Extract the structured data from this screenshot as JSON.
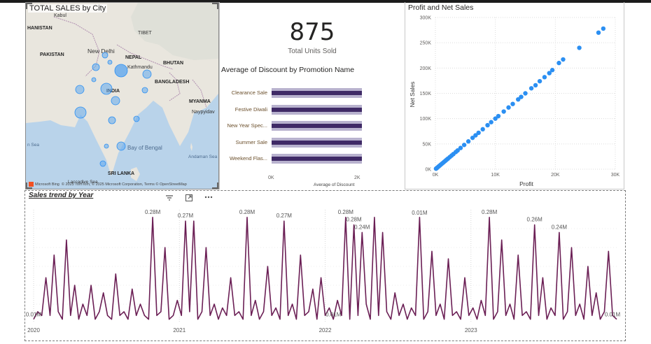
{
  "map": {
    "title": "TOTAL SALES by City",
    "labels": {
      "kabul": "Kabul",
      "afghanistan": "HANISTAN",
      "pakistan": "PAKISTAN",
      "tibet": "TIBET",
      "new_delhi": "New Delhi",
      "nepal": "NEPAL",
      "kathmandu": "Kathmandu",
      "bhutan": "BHUTAN",
      "india": "INDIA",
      "bangladesh": "BANGLADESH",
      "myanmar": "MYANMA",
      "naypyidaw": "Naypyidav",
      "bay_of_bengal": "Bay of Bengal",
      "arabian_sea": "n Sea",
      "andaman_sea": "Andaman Sea",
      "sri_lanka": "SRI LANKA",
      "laccadive": "Laccadive Sea"
    },
    "attribution": "© 2025 TomTom, © 2025 Microsoft Corporation, Terms © OpenStreetMap",
    "bing_label": "Microsoft Bing"
  },
  "kpi": {
    "value": "875",
    "label": "Total Units Sold"
  },
  "discount": {
    "title": "Average of Discount by Promotion Name",
    "xlabel": "Average of Discount",
    "ticks": [
      "0K",
      "2K"
    ],
    "categories": [
      "Clearance Sale",
      "Festive Diwali",
      "New Year Spec...",
      "Summer Sale",
      "Weekend Flas..."
    ]
  },
  "scatter": {
    "title": "Profit and Net Sales",
    "xlabel": "Profit",
    "ylabel": "Net Sales",
    "xticks": [
      "0K",
      "10K",
      "20K",
      "30K"
    ],
    "yticks": [
      "0K",
      "50K",
      "100K",
      "150K",
      "200K",
      "250K",
      "300K"
    ],
    "color": "#2b8ff2"
  },
  "line": {
    "title": "Sales trend by Year",
    "years": [
      "2020",
      "2021",
      "2022",
      "2023"
    ],
    "color": "#6b1f55",
    "icons": [
      "filter-icon",
      "focus-mode-icon",
      "more-options-icon"
    ]
  },
  "chart_data": [
    {
      "type": "bar",
      "title": "Average of Discount by Promotion Name",
      "categories": [
        "Clearance Sale",
        "Festive Diwali",
        "New Year Spec...",
        "Summer Sale",
        "Weekend Flas..."
      ],
      "values": [
        2100,
        2100,
        2100,
        2100,
        2100
      ],
      "xlabel": "Average of Discount",
      "xlim": [
        0,
        2000
      ],
      "orientation": "horizontal"
    },
    {
      "type": "scatter",
      "title": "Profit and Net Sales",
      "xlabel": "Profit",
      "ylabel": "Net Sales",
      "xlim": [
        0,
        30000
      ],
      "ylim": [
        0,
        300000
      ],
      "x": [
        28000,
        27200,
        24000,
        21300,
        20600,
        19500,
        19000,
        18200,
        17400,
        16700,
        16000,
        15000,
        14300,
        13800,
        12900,
        12200,
        11400,
        10500,
        10000,
        9300,
        8700,
        7900,
        7200,
        6700,
        6200,
        5500,
        4800,
        4200,
        3700,
        3400,
        3000,
        2700,
        2400,
        2100,
        1900,
        1700,
        1500,
        1300,
        1100,
        900,
        700,
        500,
        300,
        200,
        100
      ],
      "y": [
        278000,
        270000,
        240000,
        217000,
        210000,
        196000,
        190000,
        182000,
        174000,
        166000,
        160000,
        150000,
        143000,
        138000,
        129000,
        122000,
        114000,
        105000,
        100000,
        93000,
        87000,
        79000,
        72000,
        67000,
        62000,
        55000,
        48000,
        42000,
        37000,
        34000,
        30000,
        27000,
        24000,
        21000,
        19000,
        17000,
        15000,
        13000,
        11000,
        9000,
        7000,
        5000,
        3000,
        2000,
        1000
      ],
      "grid": true
    },
    {
      "type": "line",
      "title": "Sales trend by Year",
      "xlabel": "",
      "ylabel": "",
      "categories": [
        "2020",
        "2021",
        "2022",
        "2023"
      ],
      "ylim": [
        0,
        0.3
      ],
      "unit": "M",
      "values": [
        0.01,
        0.03,
        0.02,
        0.12,
        0.02,
        0.18,
        0.03,
        0.01,
        0.22,
        0.02,
        0.1,
        0.01,
        0.05,
        0.02,
        0.1,
        0.01,
        0.03,
        0.08,
        0.02,
        0.01,
        0.13,
        0.02,
        0.03,
        0.01,
        0.09,
        0.02,
        0.05,
        0.02,
        0.01,
        0.28,
        0.02,
        0.03,
        0.2,
        0.01,
        0.02,
        0.06,
        0.02,
        0.27,
        0.03,
        0.27,
        0.01,
        0.03,
        0.2,
        0.02,
        0.05,
        0.01,
        0.04,
        0.02,
        0.12,
        0.02,
        0.03,
        0.01,
        0.28,
        0.02,
        0.06,
        0.01,
        0.03,
        0.15,
        0.02,
        0.04,
        0.01,
        0.27,
        0.02,
        0.05,
        0.01,
        0.18,
        0.02,
        0.03,
        0.09,
        0.01,
        0.12,
        0.02,
        0.04,
        0.01,
        0.06,
        0.02,
        0.28,
        0.01,
        0.26,
        0.02,
        0.24,
        0.05,
        0.01,
        0.28,
        0.02,
        0.24,
        0.03,
        0.01,
        0.08,
        0.02,
        0.05,
        0.01,
        0.04,
        0.02,
        0.28,
        0.01,
        0.03,
        0.19,
        0.02,
        0.05,
        0.01,
        0.17,
        0.02,
        0.03,
        0.01,
        0.12,
        0.02,
        0.04,
        0.01,
        0.06,
        0.02,
        0.28,
        0.01,
        0.03,
        0.22,
        0.02,
        0.05,
        0.01,
        0.18,
        0.02,
        0.03,
        0.01,
        0.26,
        0.02,
        0.12,
        0.01,
        0.04,
        0.02,
        0.24,
        0.01,
        0.03,
        0.2,
        0.02,
        0.05,
        0.01,
        0.15,
        0.02,
        0.08,
        0.01,
        0.03,
        0.19,
        0.02,
        0.01
      ],
      "data_labels": [
        "0.01M",
        "0.28M",
        "0.27M",
        "0.28M",
        "0.27M",
        "0.01M",
        "0.28M",
        "0.28M",
        "0.24M",
        "0.01M",
        "0.28M",
        "0.26M",
        "0.24M",
        "0.01M"
      ]
    }
  ]
}
